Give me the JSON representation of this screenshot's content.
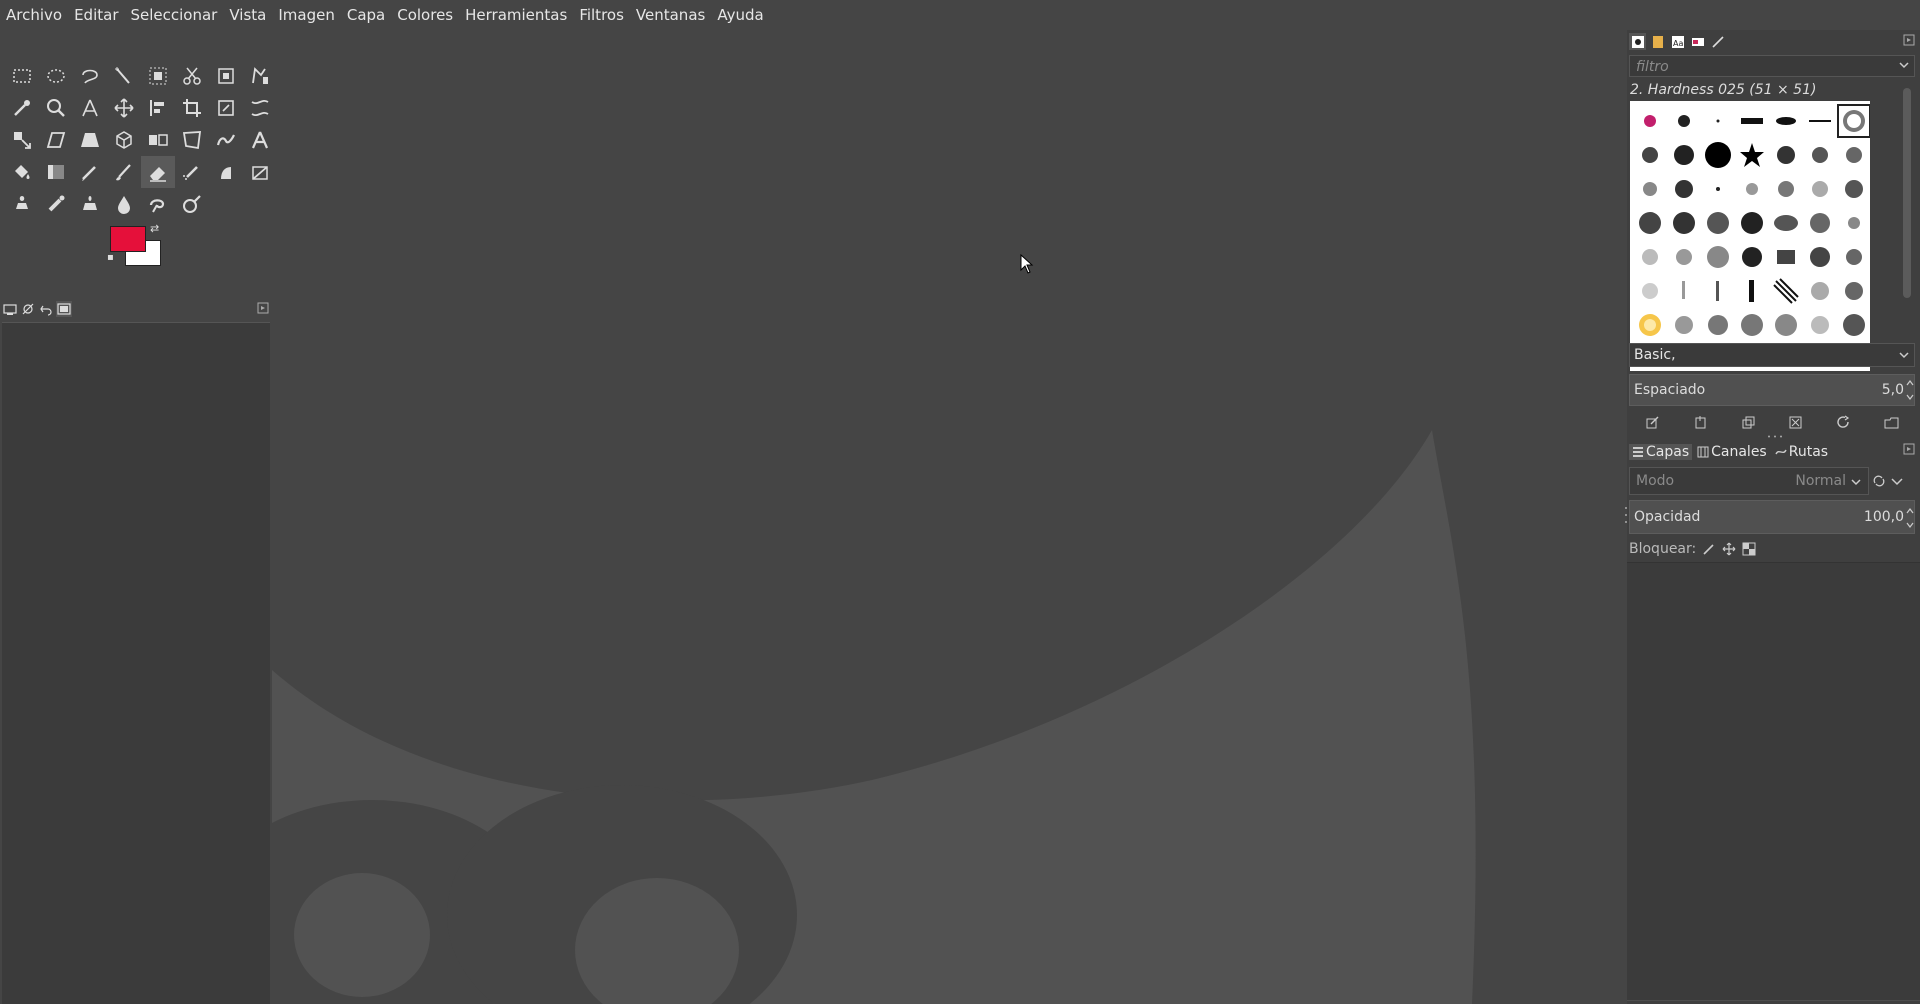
{
  "menu": [
    "Archivo",
    "Editar",
    "Seleccionar",
    "Vista",
    "Imagen",
    "Capa",
    "Colores",
    "Herramientas",
    "Filtros",
    "Ventanas",
    "Ayuda"
  ],
  "tools": [
    "rect-select",
    "ellipse-select",
    "free-select",
    "fuzzy-select",
    "foreground-select",
    "scissors-select",
    "by-color-select",
    "paths",
    "color-picker",
    "zoom",
    "measure",
    "move",
    "align",
    "crop",
    "unified-transform",
    "warp-transform",
    "scale",
    "shear",
    "perspective",
    "3d-transform",
    "flip",
    "cage-transform",
    "warp",
    "text",
    "bucket-fill",
    "gradient",
    "pencil",
    "paintbrush",
    "eraser",
    "airbrush",
    "ink",
    "mypaint-brush",
    "clone",
    "heal",
    "perspective-clone",
    "blur",
    "smudge",
    "dodge-burn"
  ],
  "active_tool": "eraser",
  "colors": {
    "foreground": "#e5103a",
    "background": "#ffffff"
  },
  "brushes": {
    "filter_placeholder": "filtro",
    "selected_name": "2. Hardness 025 (51 × 51)",
    "tag": "Basic,",
    "spacing_label": "Espaciado",
    "spacing_value": "5,0"
  },
  "layers": {
    "tabs": [
      "Capas",
      "Canales",
      "Rutas"
    ],
    "mode_label": "Modo",
    "mode_value": "Normal",
    "opacity_label": "Opacidad",
    "opacity_value": "100,0",
    "lock_label": "Bloquear:"
  }
}
